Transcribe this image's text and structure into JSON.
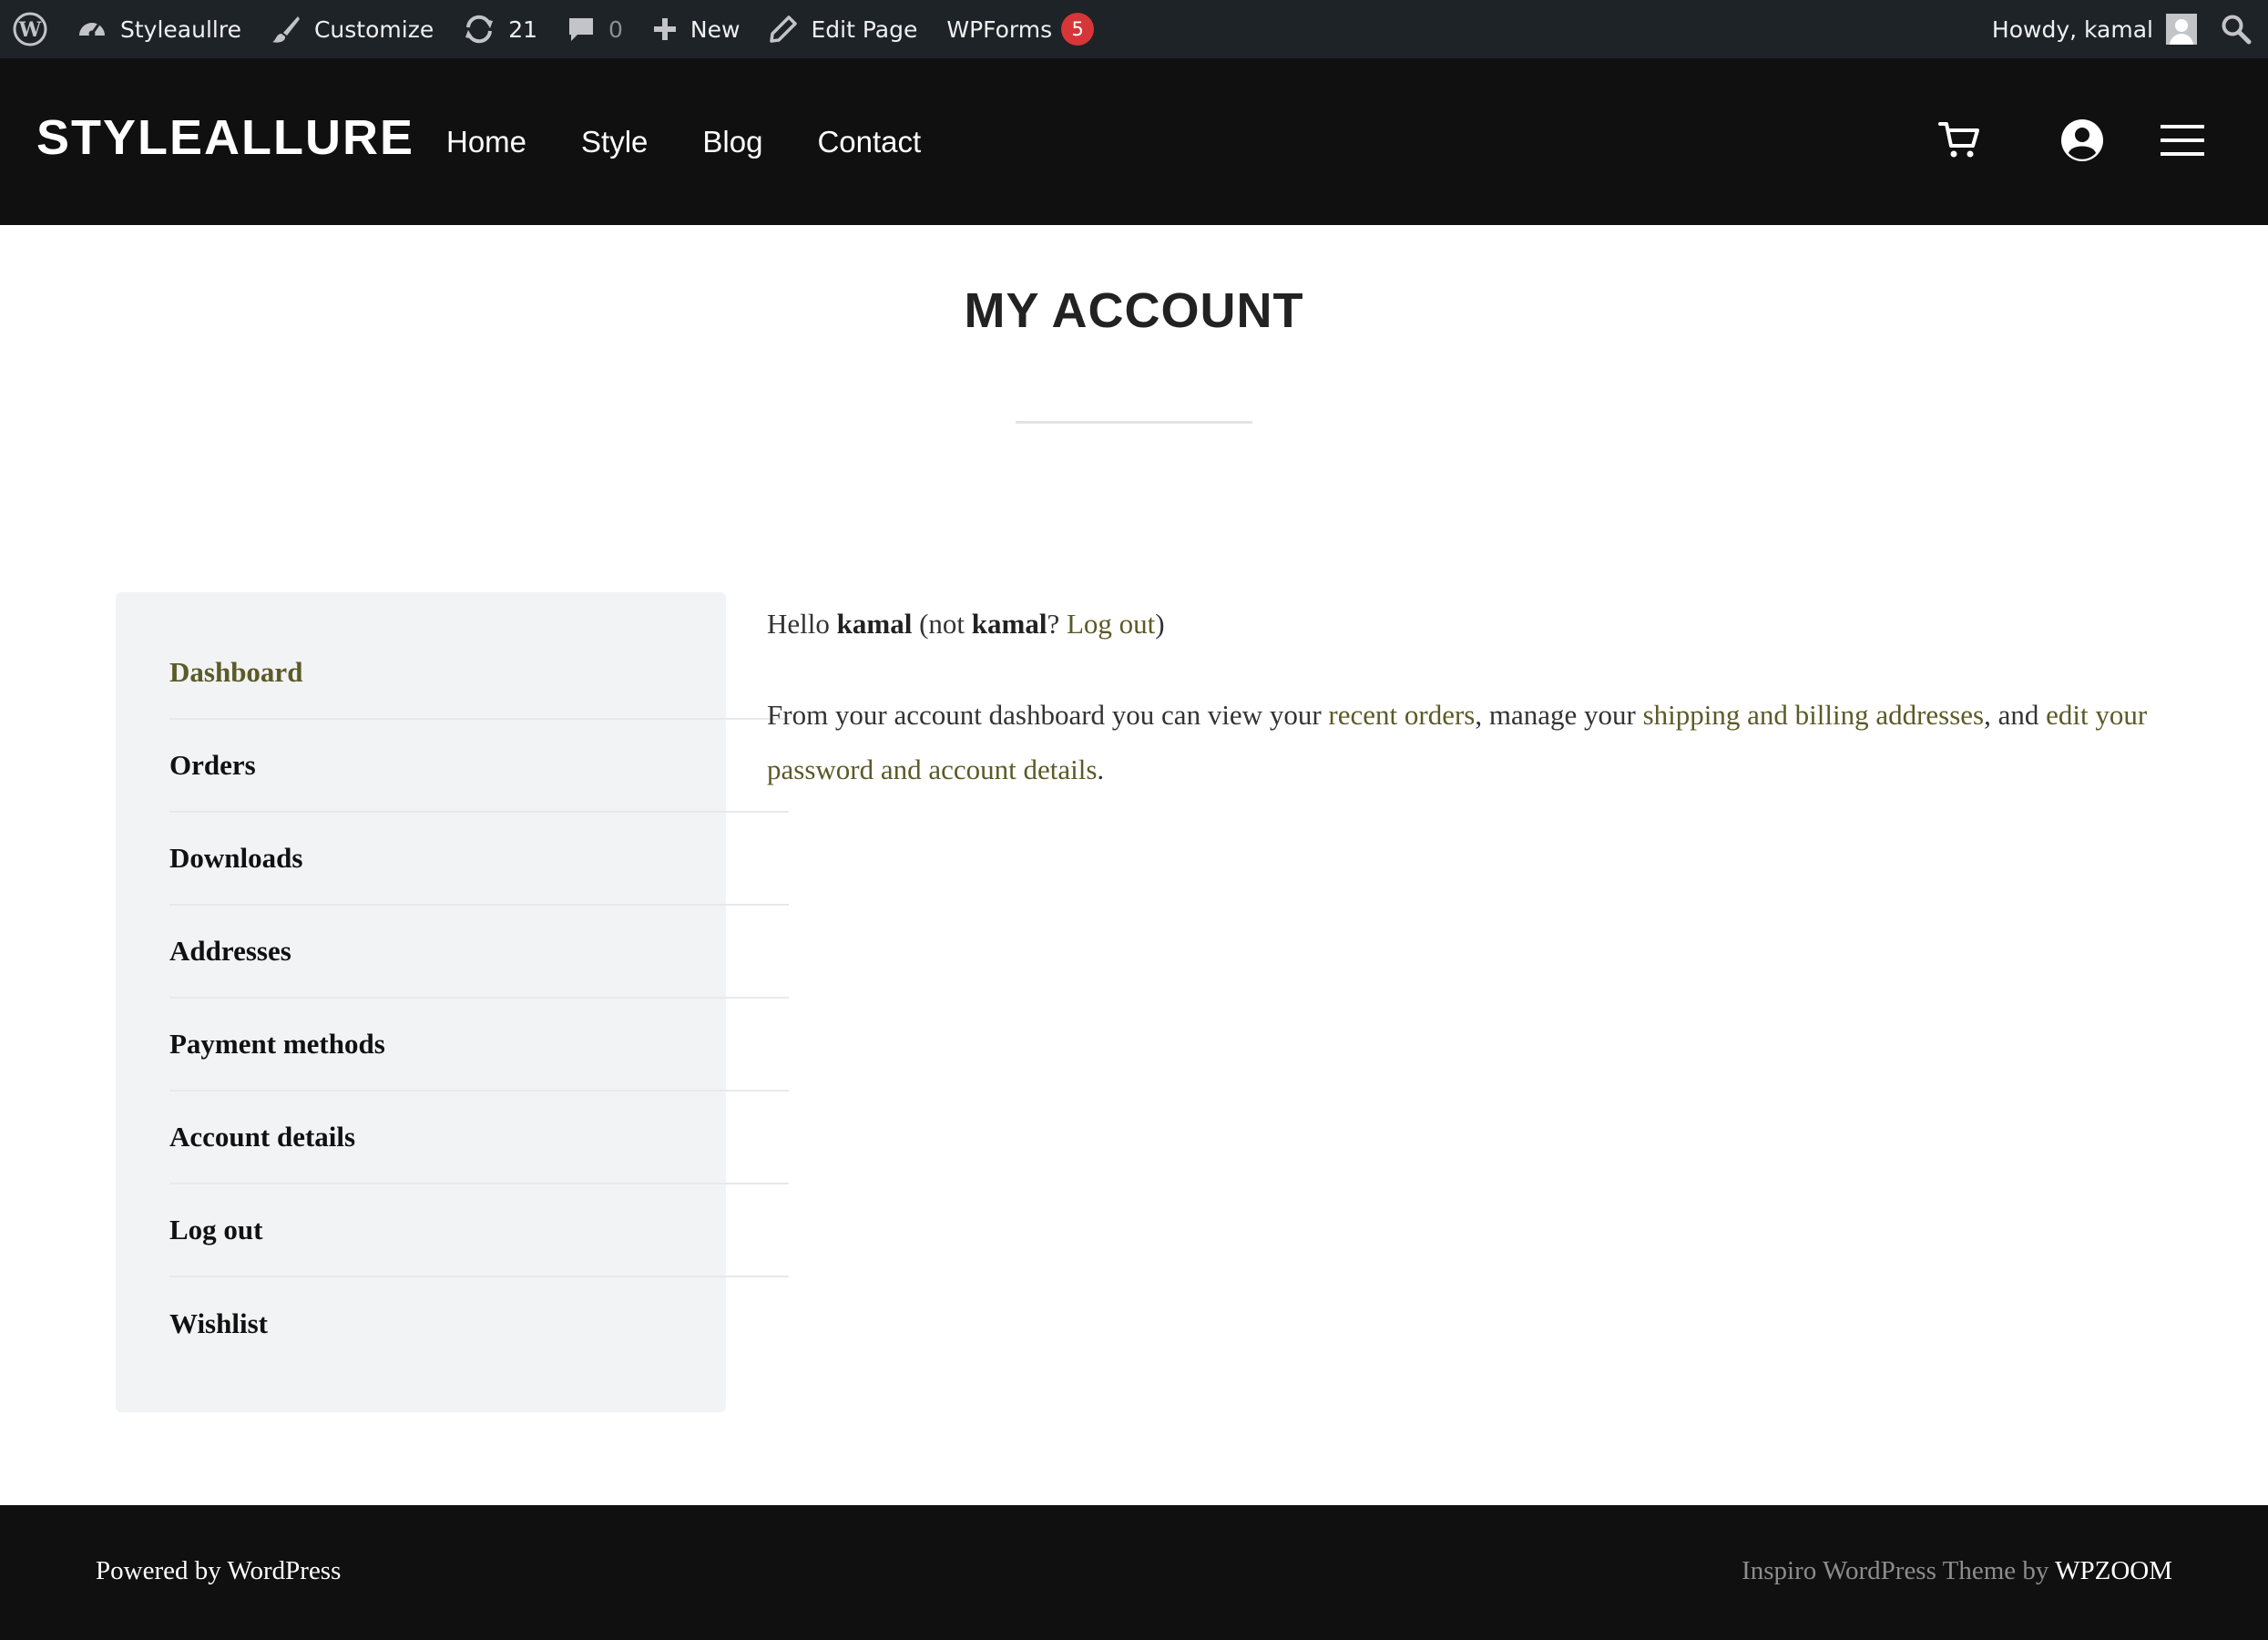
{
  "admin_bar": {
    "site_name": "Styleaullre",
    "customize": "Customize",
    "updates_count": "21",
    "comments_count": "0",
    "new": "New",
    "edit_page": "Edit Page",
    "wpforms": "WPForms",
    "wpforms_badge": "5",
    "howdy": "Howdy, kamal"
  },
  "header": {
    "logo": "STYLEALLURE",
    "nav": [
      "Home",
      "Style",
      "Blog",
      "Contact"
    ],
    "icons": [
      "cart-icon",
      "user-account-icon",
      "hamburger-menu-icon"
    ]
  },
  "page": {
    "title": "MY ACCOUNT"
  },
  "account_nav": {
    "items": [
      "Dashboard",
      "Orders",
      "Downloads",
      "Addresses",
      "Payment methods",
      "Account details",
      "Log out",
      "Wishlist"
    ],
    "active": "Dashboard"
  },
  "content": {
    "hello": "Hello ",
    "user": "kamal",
    "not_open": " (not ",
    "user2": "kamal",
    "qmark": "? ",
    "logout_link": "Log out",
    "close_paren": ")",
    "p2_a": "From your account dashboard you can view your ",
    "recent_orders": "recent orders",
    "p2_b": ", manage your ",
    "addresses_link": "shipping and billing addresses",
    "p2_c": ", and ",
    "edit_link": "edit your password and account details",
    "p2_d": "."
  },
  "footer": {
    "left": "Powered by WordPress",
    "right_prefix": "Inspiro WordPress Theme by ",
    "right_brand": "WPZOOM"
  },
  "colors": {
    "admin_bar": "#1d2327",
    "header": "#101010",
    "accent": "#5c5a27",
    "badge": "#d63638",
    "sidebar_bg": "#f2f3f4"
  }
}
